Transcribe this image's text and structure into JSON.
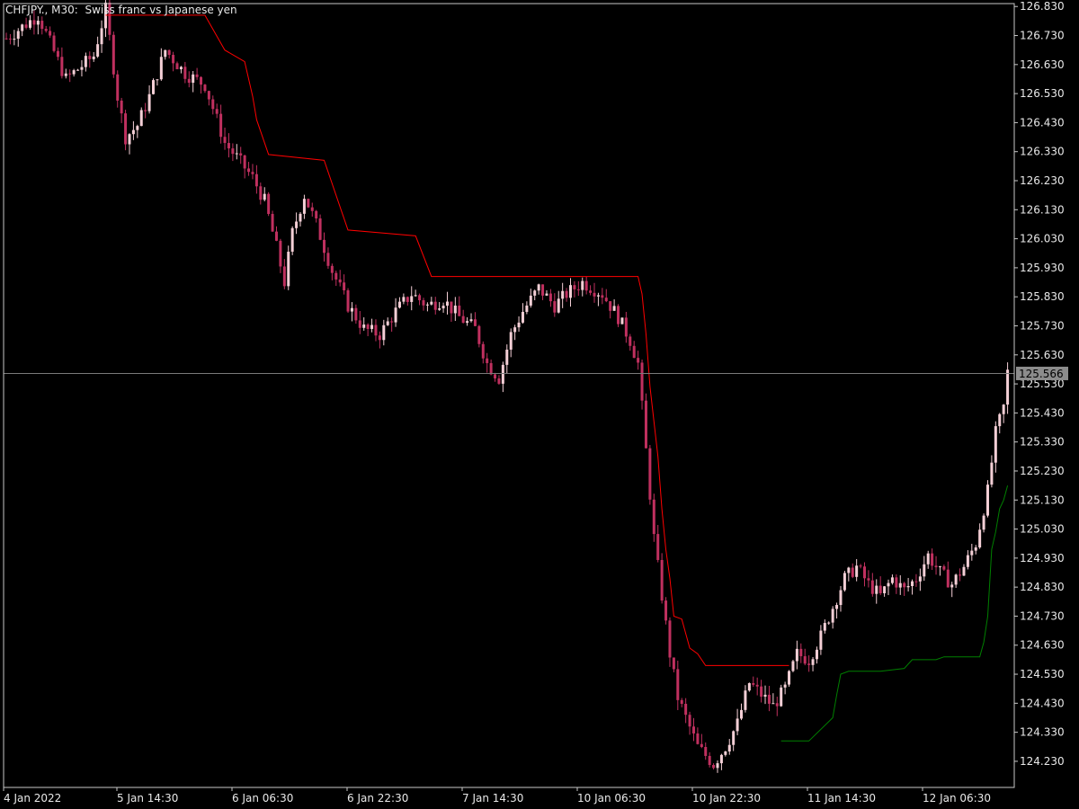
{
  "header": {
    "title": "CHFJPY., M30:  Swiss franc vs Japanese yen"
  },
  "colors": {
    "background": "#000000",
    "axis": "#c8c8c8",
    "text": "#e8e8e8",
    "bull_candle": "#f4cfd6",
    "bear_candle": "#c0305f",
    "upper_line": "#ff0000",
    "lower_line": "#008000",
    "price_line": "#7a7a7a",
    "price_tag_bg": "#8c8c8c"
  },
  "chart_data": {
    "type": "candlestick",
    "y_axis_side": "right",
    "ylim": [
      124.14,
      126.84
    ],
    "y_ticks": [
      "126.830",
      "126.730",
      "126.630",
      "126.530",
      "126.430",
      "126.330",
      "126.230",
      "126.130",
      "126.030",
      "125.930",
      "125.830",
      "125.730",
      "125.630",
      "125.530",
      "125.430",
      "125.330",
      "125.230",
      "125.130",
      "125.030",
      "124.930",
      "124.830",
      "124.730",
      "124.630",
      "124.530",
      "124.430",
      "124.330",
      "124.230"
    ],
    "x_ticks": [
      "4 Jan 2022",
      "5 Jan 14:30",
      "6 Jan 06:30",
      "6 Jan 22:30",
      "7 Jan 14:30",
      "10 Jan 06:30",
      "10 Jan 22:30",
      "11 Jan 14:30",
      "12 Jan 06:30"
    ],
    "current_price": "125.566",
    "close_path": [
      [
        0,
        126.72
      ],
      [
        8,
        126.8
      ],
      [
        15,
        126.58
      ],
      [
        22,
        126.66
      ],
      [
        25,
        126.82
      ],
      [
        28,
        126.52
      ],
      [
        30,
        126.38
      ],
      [
        33,
        126.42
      ],
      [
        36,
        126.52
      ],
      [
        40,
        126.68
      ],
      [
        45,
        126.6
      ],
      [
        50,
        126.56
      ],
      [
        55,
        126.36
      ],
      [
        58,
        126.31
      ],
      [
        62,
        126.24
      ],
      [
        65,
        126.16
      ],
      [
        68,
        126.0
      ],
      [
        70,
        125.88
      ],
      [
        72,
        126.05
      ],
      [
        75,
        126.18
      ],
      [
        78,
        126.08
      ],
      [
        82,
        125.92
      ],
      [
        86,
        125.8
      ],
      [
        90,
        125.72
      ],
      [
        94,
        125.7
      ],
      [
        98,
        125.78
      ],
      [
        102,
        125.84
      ],
      [
        106,
        125.8
      ],
      [
        110,
        125.82
      ],
      [
        114,
        125.76
      ],
      [
        118,
        125.72
      ],
      [
        121,
        125.6
      ],
      [
        124,
        125.55
      ],
      [
        127,
        125.7
      ],
      [
        130,
        125.78
      ],
      [
        134,
        125.86
      ],
      [
        138,
        125.8
      ],
      [
        141,
        125.84
      ],
      [
        145,
        125.88
      ],
      [
        150,
        125.84
      ],
      [
        154,
        125.76
      ],
      [
        157,
        125.68
      ],
      [
        159,
        125.6
      ],
      [
        161,
        125.3
      ],
      [
        163,
        125.0
      ],
      [
        165,
        124.8
      ],
      [
        167,
        124.6
      ],
      [
        169,
        124.45
      ],
      [
        171,
        124.38
      ],
      [
        174,
        124.28
      ],
      [
        178,
        124.22
      ],
      [
        181,
        124.28
      ],
      [
        184,
        124.36
      ],
      [
        187,
        124.5
      ],
      [
        190,
        124.46
      ],
      [
        193,
        124.42
      ],
      [
        196,
        124.48
      ],
      [
        199,
        124.6
      ],
      [
        202,
        124.58
      ],
      [
        205,
        124.66
      ],
      [
        208,
        124.76
      ],
      [
        211,
        124.86
      ],
      [
        214,
        124.9
      ],
      [
        217,
        124.84
      ],
      [
        220,
        124.8
      ],
      [
        223,
        124.86
      ],
      [
        226,
        124.82
      ],
      [
        229,
        124.86
      ],
      [
        232,
        124.94
      ],
      [
        235,
        124.88
      ],
      [
        238,
        124.84
      ],
      [
        241,
        124.9
      ],
      [
        244,
        124.98
      ],
      [
        247,
        125.16
      ],
      [
        249,
        125.36
      ],
      [
        251,
        125.45
      ],
      [
        252,
        125.57
      ]
    ],
    "series": [
      {
        "style": "red",
        "x": [
          25,
          50,
          55,
          60,
          62,
          63,
          66,
          80,
          86,
          103,
          107,
          128,
          138,
          159,
          160,
          161,
          162,
          163,
          164,
          165,
          166,
          167,
          168,
          170,
          172,
          174,
          176,
          195,
          197
        ],
        "y": [
          126.8,
          126.8,
          126.68,
          126.64,
          126.52,
          126.44,
          126.32,
          126.3,
          126.06,
          126.04,
          125.9,
          125.9,
          125.9,
          125.9,
          125.84,
          125.7,
          125.52,
          125.4,
          125.28,
          125.1,
          124.96,
          124.86,
          124.73,
          124.72,
          124.62,
          124.6,
          124.56,
          124.56,
          124.56
        ]
      },
      {
        "style": "green",
        "x": [
          195,
          202,
          208,
          209,
          210,
          212,
          220,
          226,
          228,
          234,
          236,
          245,
          246,
          247,
          248,
          249,
          250,
          251,
          252
        ],
        "y": [
          124.3,
          124.3,
          124.38,
          124.46,
          124.53,
          124.54,
          124.54,
          124.55,
          124.58,
          124.58,
          124.59,
          124.59,
          124.64,
          124.73,
          124.96,
          125.02,
          125.1,
          125.13,
          125.18
        ]
      }
    ]
  }
}
